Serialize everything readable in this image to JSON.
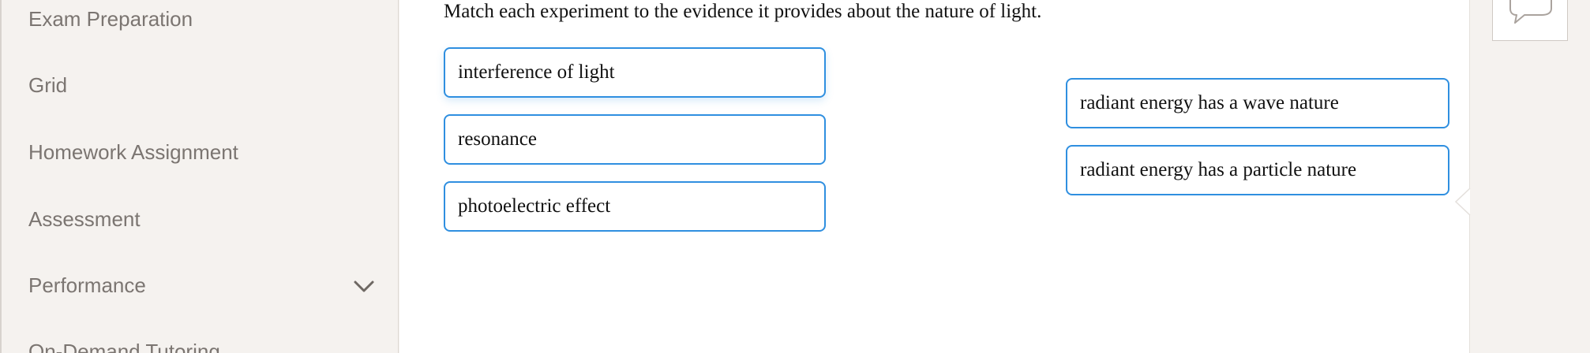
{
  "sidebar": {
    "items": [
      {
        "label": "Exam Preparation"
      },
      {
        "label": "Grid"
      },
      {
        "label": "Homework Assignment"
      },
      {
        "label": "Assessment"
      },
      {
        "label": "Performance"
      },
      {
        "label": "On-Demand Tutoring"
      }
    ],
    "performance_expand_icon": "chevron-down-icon"
  },
  "question": {
    "instructions": "Match each experiment to the evidence it provides about the nature of light.",
    "experiments": [
      {
        "label": "interference of light"
      },
      {
        "label": "resonance"
      },
      {
        "label": "photoelectric effect"
      }
    ],
    "evidence": [
      {
        "label": "radiant energy has a wave nature"
      },
      {
        "label": "radiant energy has a particle nature"
      }
    ]
  },
  "rail": {
    "chat_icon": "speech-bubble-icon"
  },
  "colors": {
    "tile_border": "#2f8fe0",
    "sidebar_text": "#7b7571",
    "sidebar_bg": "#f5f2ef"
  }
}
